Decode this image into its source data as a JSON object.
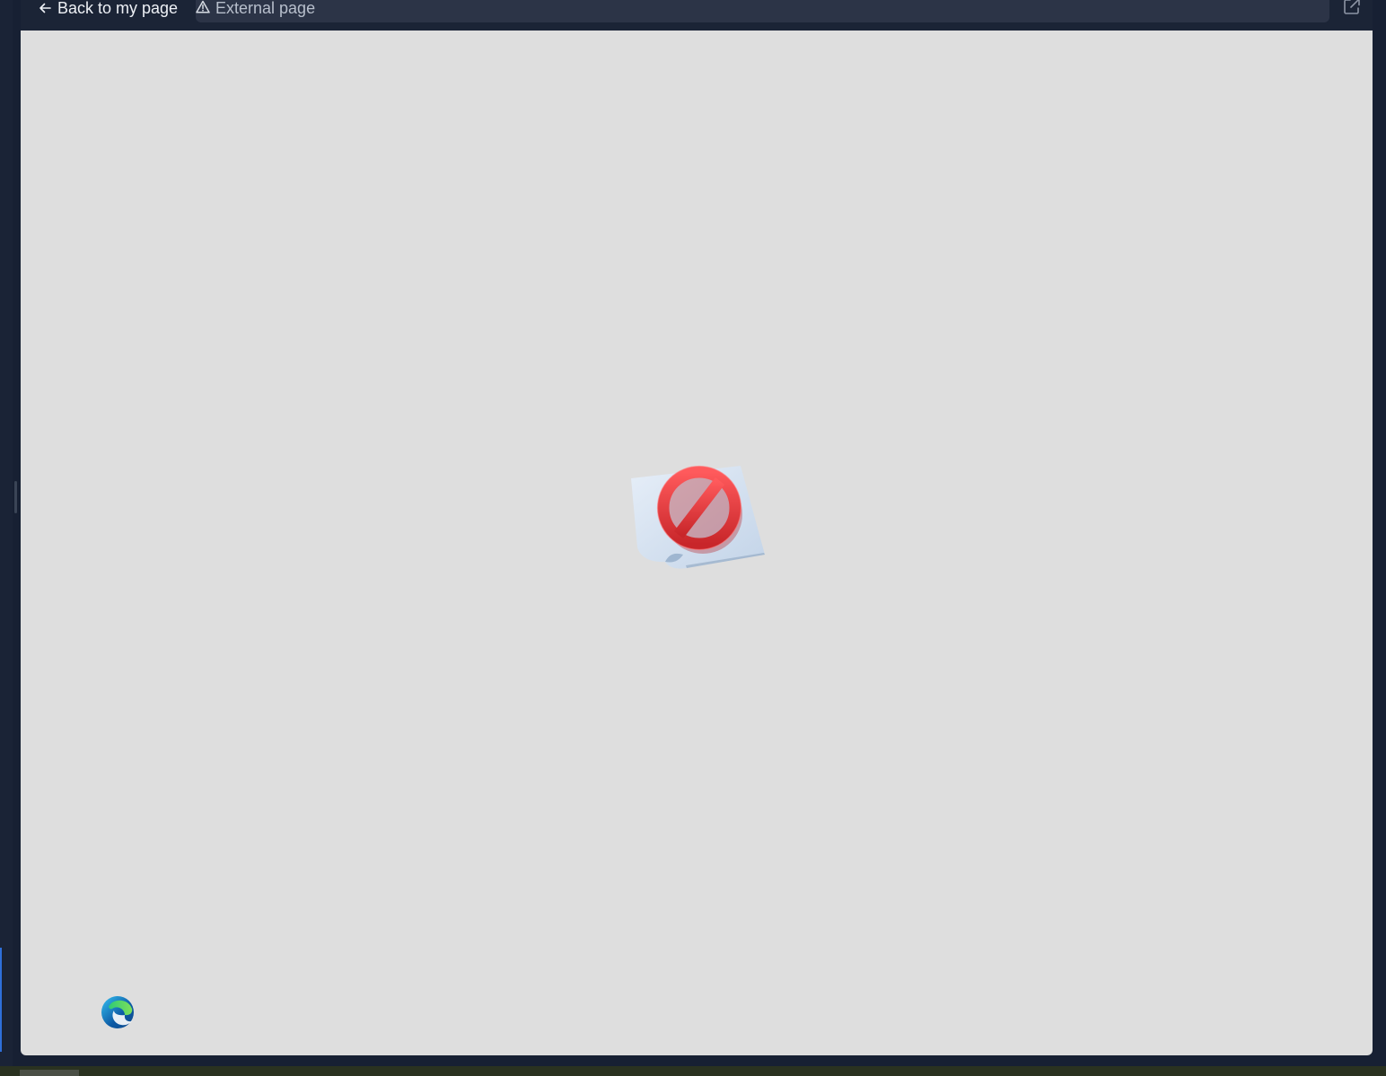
{
  "toolbar": {
    "back_label": "Back to my page",
    "back_icon": "arrow-left-icon",
    "url_label": "External page",
    "warning_icon": "warning-triangle-icon",
    "open_external_icon": "open-external-icon"
  },
  "content": {
    "illustration_icon": "blocked-page-icon",
    "browser_logo_icon": "edge-logo-icon"
  },
  "colors": {
    "frame": "#172033",
    "toolbar": "#1b2436",
    "url_bar": "#2c3447",
    "content_bg": "#dedede",
    "blocked_red": "#e8363a"
  }
}
